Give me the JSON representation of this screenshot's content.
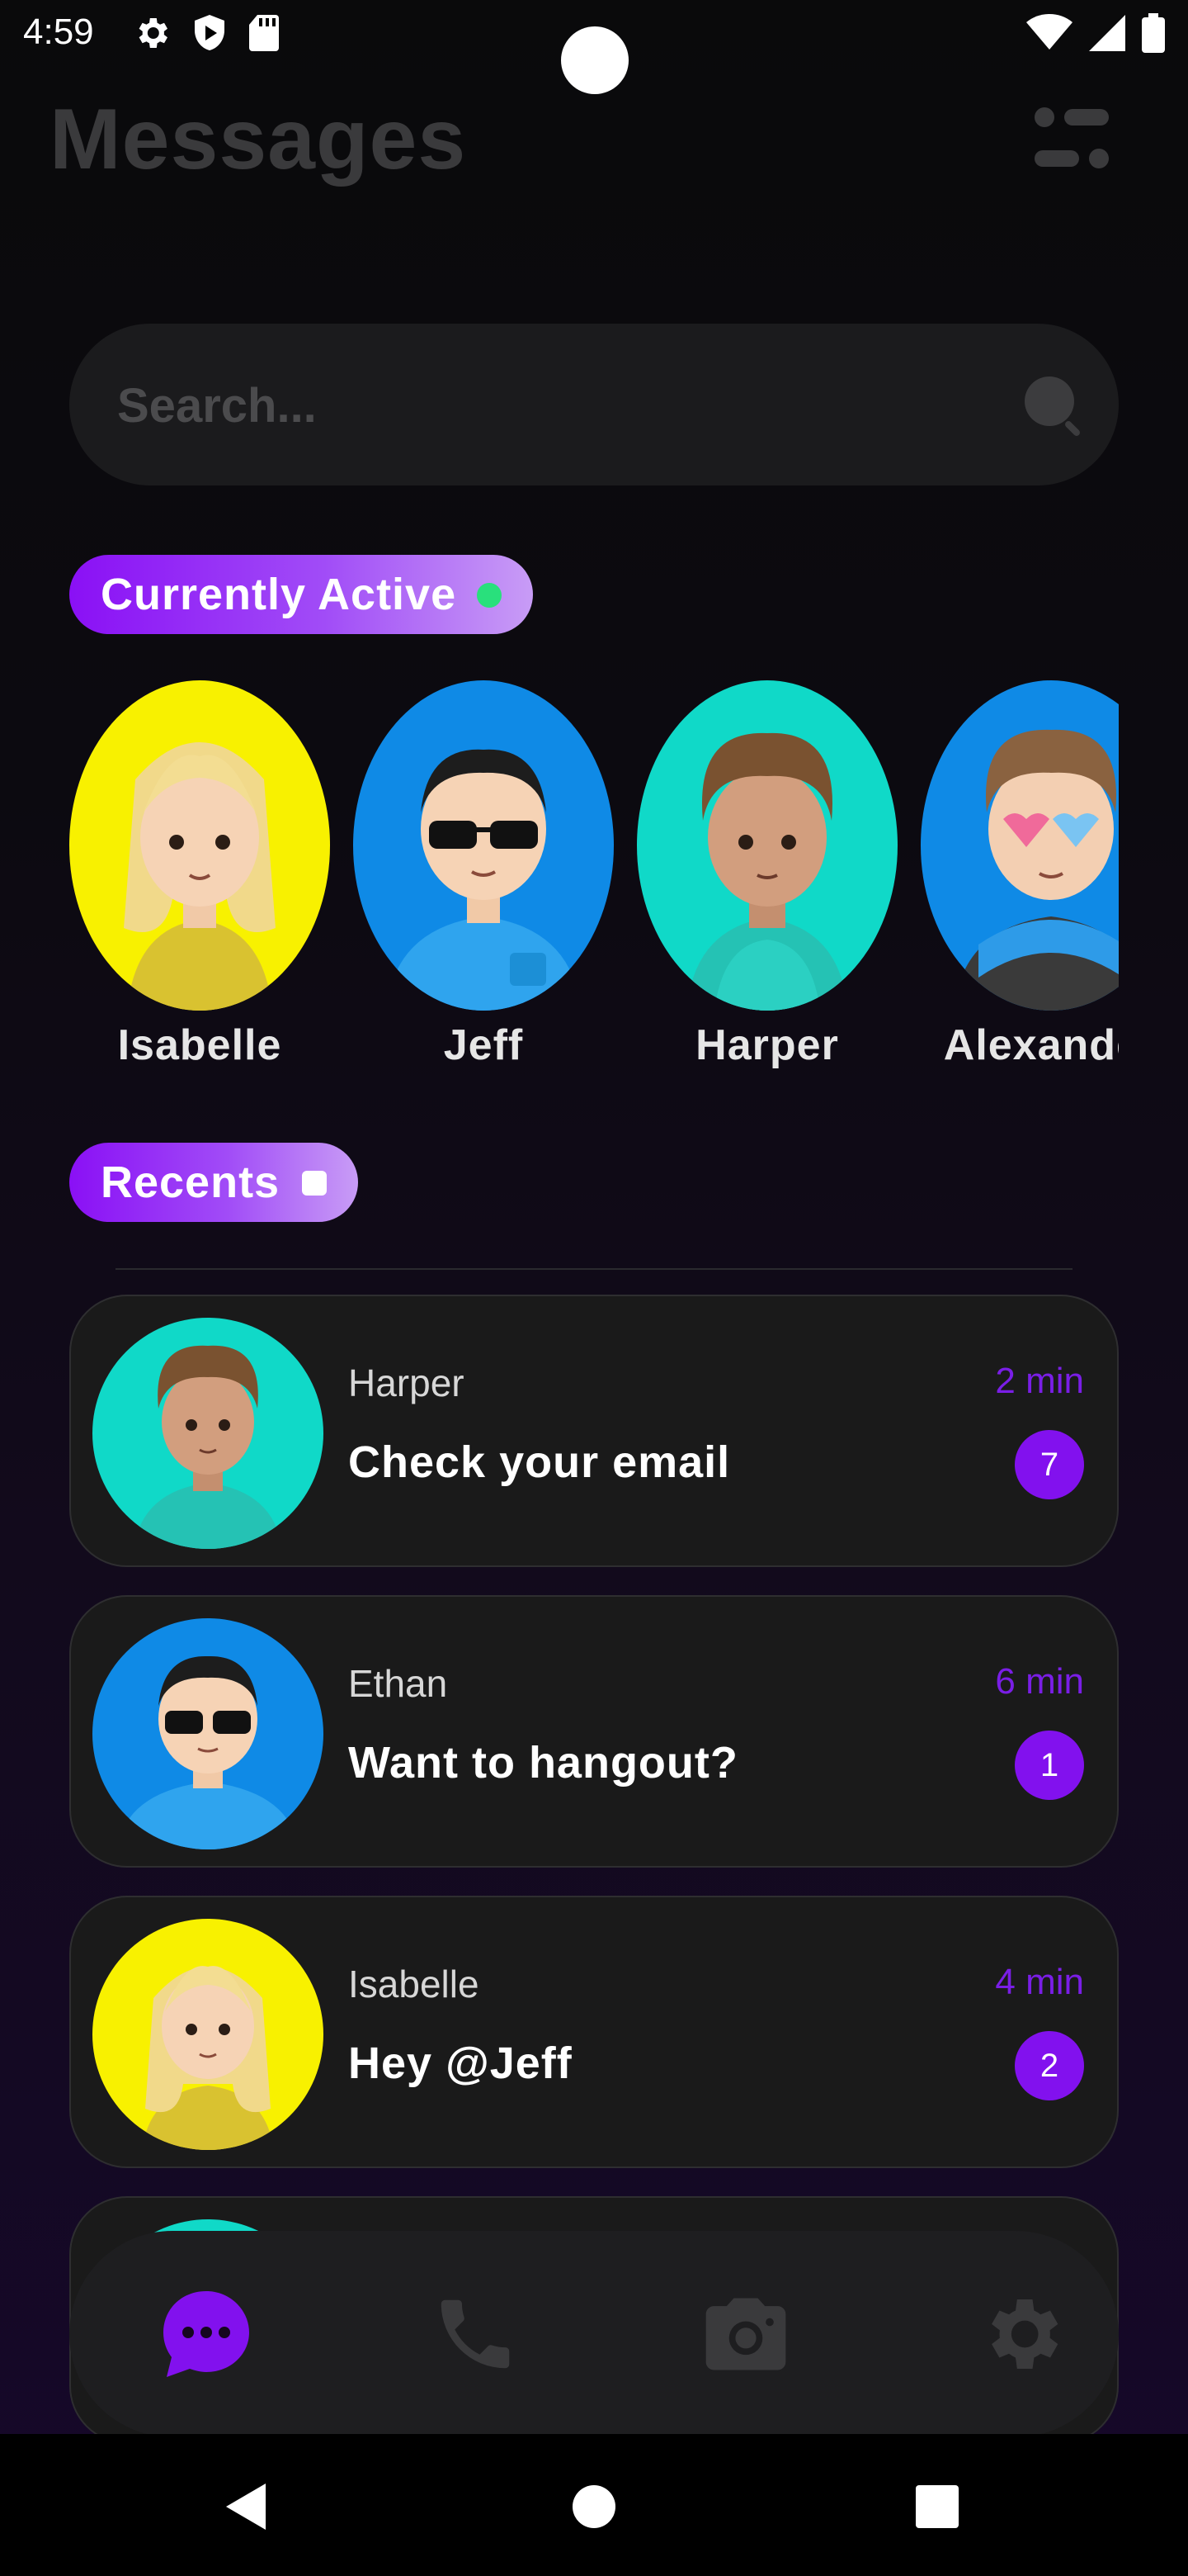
{
  "status_bar": {
    "time": "4:59"
  },
  "header": {
    "title": "Messages"
  },
  "search": {
    "placeholder": "Search..."
  },
  "active_section": {
    "label": "Currently Active",
    "users": [
      {
        "name": "Isabelle",
        "bg": "#f8f100"
      },
      {
        "name": "Jeff",
        "bg": "#0f8ae6"
      },
      {
        "name": "Harper",
        "bg": "#10d9c8"
      },
      {
        "name": "Alexander",
        "bg": "#0f8ae6"
      }
    ]
  },
  "recents_section": {
    "label": "Recents",
    "items": [
      {
        "name": "Harper",
        "message": "Check your email",
        "time": "2 min",
        "unread": "7",
        "bg": "#10d9c8"
      },
      {
        "name": "Ethan",
        "message": "Want to hangout?",
        "time": "6 min",
        "unread": "1",
        "bg": "#0f8ae6"
      },
      {
        "name": "Isabelle",
        "message": "Hey @Jeff",
        "time": "4 min",
        "unread": "2",
        "bg": "#f8f100"
      }
    ]
  },
  "bottom_nav": {
    "items": [
      {
        "icon": "chat-icon",
        "active": true
      },
      {
        "icon": "phone-icon",
        "active": false
      },
      {
        "icon": "camera-icon",
        "active": false
      },
      {
        "icon": "gear-icon",
        "active": false
      }
    ]
  },
  "colors": {
    "accent": "#8211ee",
    "online": "#29e07c",
    "card": "#1a1a1a"
  }
}
